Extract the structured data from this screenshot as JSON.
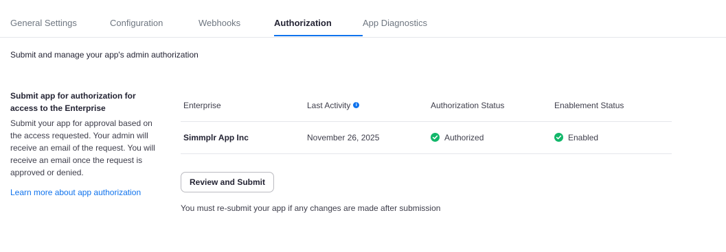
{
  "tabs": [
    {
      "label": "General Settings"
    },
    {
      "label": "Configuration"
    },
    {
      "label": "Webhooks"
    },
    {
      "label": "Authorization"
    },
    {
      "label": "App Diagnostics"
    }
  ],
  "active_tab": "Authorization",
  "subtitle": "Submit and manage your app's admin authorization",
  "left_panel": {
    "title": "Submit app for authorization for access to the Enterprise",
    "description": "Submit your app for approval based on the access requested. Your admin will receive an email of the request. You will receive an email once the request is approved or denied.",
    "link": "Learn more about app authorization"
  },
  "table": {
    "headers": [
      "Enterprise",
      "Last Activity",
      "Authorization Status",
      "Enablement Status"
    ],
    "rows": [
      {
        "enterprise": "Simmplr App Inc",
        "last_activity": "November 26, 2025",
        "authorization_status": "Authorized",
        "enablement_status": "Enabled"
      }
    ]
  },
  "review_button": "Review and Submit",
  "note": "You must re-submit your app if any changes are made after submission",
  "colors": {
    "accent": "#0e72ed",
    "success": "#12b76a"
  },
  "icons": {
    "last_activity_info": "info-icon",
    "authorized": "check-circle-icon",
    "enabled": "check-circle-icon"
  }
}
